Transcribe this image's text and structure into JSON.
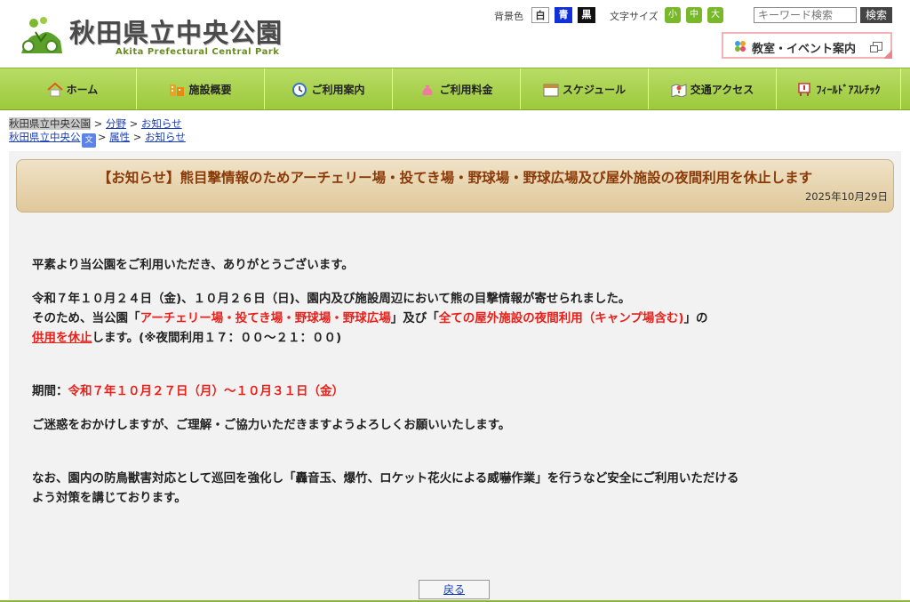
{
  "header": {
    "site_title": "秋田県立中央公園",
    "site_subtitle": "Akita Prefectural Central Park",
    "bg_color_label": "背景色",
    "bg_options": [
      "白",
      "青",
      "黒"
    ],
    "font_size_label": "文字サイズ",
    "font_sizes": [
      "小",
      "中",
      "大"
    ],
    "search_placeholder": "キーワード検索",
    "search_button": "検索",
    "event_link": "教室・イベント案内"
  },
  "nav": {
    "items": [
      {
        "label": "ホーム",
        "icon": "home-icon"
      },
      {
        "label": "施設概要",
        "icon": "building-icon"
      },
      {
        "label": "ご利用案内",
        "icon": "clock-icon"
      },
      {
        "label": "ご利用料金",
        "icon": "money-bag-icon"
      },
      {
        "label": "スケジュール",
        "icon": "calendar-icon"
      },
      {
        "label": "交通アクセス",
        "icon": "map-icon"
      },
      {
        "label": "ﾌｨｰﾙﾄﾞｱｽﾚﾁｯｸ",
        "icon": "signboard-icon"
      }
    ]
  },
  "breadcrumbs": {
    "row1": {
      "home": "秋田県立中央公園",
      "cat": "分野",
      "leaf": "お知らせ"
    },
    "row2": {
      "home": "秋田県立中央公",
      "cat": "属性",
      "leaf": "お知らせ"
    },
    "sep": ">"
  },
  "article": {
    "title": "【お知らせ】熊目撃情報のためアーチェリー場・投てき場・野球場・野球広場及び屋外施設の夜間利用を休止します",
    "date": "2025年10月29日",
    "p1": "平素より当公園をご利用いただき、ありがとうございます。",
    "p2_line1": "令和７年１０月２４日（金)、１０月２６日（日)、園内及び施設周辺において熊の目撃情報が寄せられました。",
    "p2_line2_a": "そのため、当公園「",
    "p2_line2_red1": "アーチェリー場・投てき場・野球場・野球広場",
    "p2_line2_b": "」及び「",
    "p2_line2_red2": "全ての屋外施設の夜間利用（キャンプ場含む)",
    "p2_line2_c": "」の",
    "p2_line3_red": "供用を休止",
    "p2_line3_rest": "します。(※夜間利用１７：００～２１：００)",
    "period_label": "期間：",
    "period_value": "令和７年１０月２７日（月）～１０月３１日（金）",
    "p4": "ご迷惑をおかけしますが、ご理解・ご協力いただきますようよろしくお願いいたします。",
    "p5_line1": "なお、園内の防鳥獣害対応として巡回を強化し「轟音玉、爆竹、ロケット花火による威嚇作業」を行うなど安全にご利用いただける",
    "p5_line2": "よう対策を講じております。"
  },
  "back_button": "戻る",
  "colors": {
    "nav_green": "#9cc93b",
    "banner_title": "#8a3a08",
    "alert_red": "#e8201a",
    "link_blue": "#1a3fb5"
  }
}
